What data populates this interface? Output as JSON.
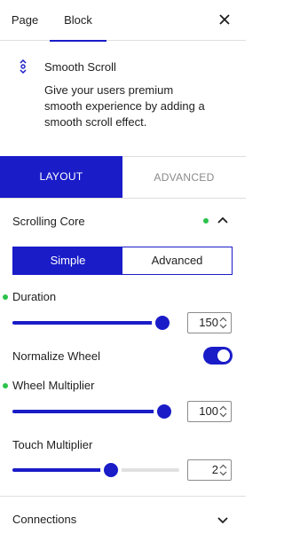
{
  "tabs": {
    "page": "Page",
    "block": "Block",
    "active": "Block"
  },
  "icons": {
    "close": "close-icon",
    "block": "smooth-scroll-block-icon",
    "expand": "chevron-up-icon",
    "collapse": "chevron-down-icon",
    "stepper": "stepper-arrows-icon"
  },
  "block": {
    "title": "Smooth Scroll",
    "description": "Give your users premium smooth experience by adding a smooth scroll effect."
  },
  "panel_tabs": {
    "layout": "LAYOUT",
    "advanced": "ADVANCED",
    "active": "LAYOUT"
  },
  "scrolling_core": {
    "title": "Scrolling Core",
    "modes": {
      "simple": "Simple",
      "advanced": "Advanced",
      "selected": "Simple"
    },
    "duration": {
      "label": "Duration",
      "value": "150",
      "fill": 0.95
    },
    "normalize_wheel": {
      "label": "Normalize Wheel",
      "enabled": true
    },
    "wheel_multiplier": {
      "label": "Wheel Multiplier",
      "value": "100",
      "fill": 0.96
    },
    "touch_multiplier": {
      "label": "Touch Multiplier",
      "value": "2",
      "fill": 0.59
    }
  },
  "connections": {
    "title": "Connections"
  },
  "colors": {
    "accent": "#1a1cc8",
    "indicator": "#2bc24a",
    "muted": "#8a8a8a"
  }
}
